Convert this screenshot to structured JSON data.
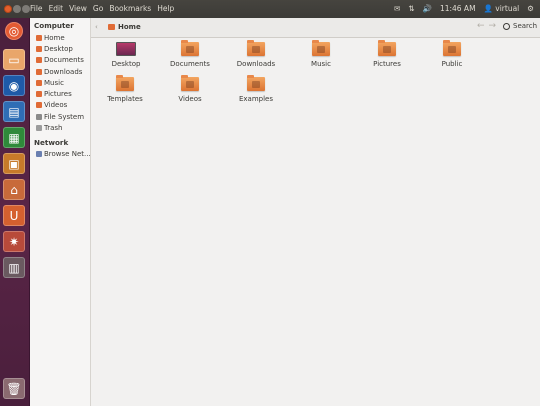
{
  "menubar": {
    "items": [
      "File",
      "Edit",
      "View",
      "Go",
      "Bookmarks",
      "Help"
    ],
    "clock": "11:46 AM",
    "user": "virtual"
  },
  "launcher": {
    "items": [
      "dash-home",
      "files",
      "firefox",
      "writer",
      "calc",
      "impress",
      "software-center",
      "ubuntu-one",
      "system-settings",
      "workspaces",
      "trash"
    ]
  },
  "sidebar": {
    "computer_heading": "Computer",
    "computer_items": [
      "Home",
      "Desktop",
      "Documents",
      "Downloads",
      "Music",
      "Pictures",
      "Videos",
      "File System",
      "Trash"
    ],
    "network_heading": "Network",
    "network_items": [
      "Browse Net..."
    ]
  },
  "toolbar": {
    "breadcrumb": "Home",
    "search_label": "Search"
  },
  "files": {
    "items": [
      "Desktop",
      "Documents",
      "Downloads",
      "Music",
      "Pictures",
      "Public",
      "Templates",
      "Videos",
      "Examples"
    ]
  },
  "colors": {
    "accent_orange": "#e06b36",
    "launcher_bg": "#5a2547",
    "panel_bg": "#3c3b37"
  }
}
